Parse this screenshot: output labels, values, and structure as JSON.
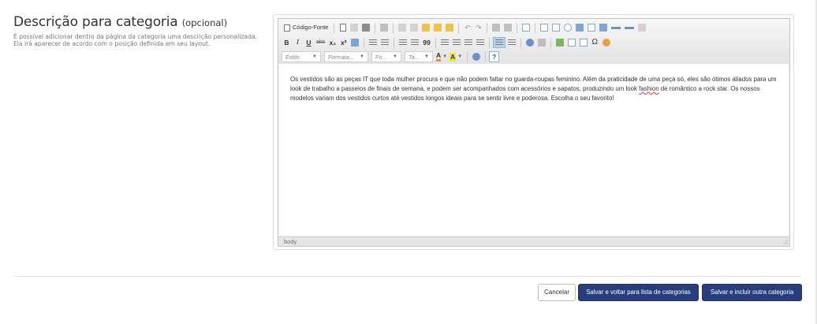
{
  "section": {
    "title": "Descrição para categoria",
    "optional_label": "(opcional)",
    "help_line1": "É possível adicionar dentro da página da categoria uma descrição personalizada.",
    "help_line2": "Ela irá aparecer de acordo com o posição definida em seu layout."
  },
  "editor": {
    "toolbar": {
      "source_label": "Código-Fonte",
      "bold_label": "B",
      "italic_label": "I",
      "underline_label": "U",
      "strike_label": "abc",
      "subscript_label": "x₂",
      "superscript_label": "x²",
      "blockquote_label": "99",
      "omega_label": "Ω",
      "style_combo": "Estilo",
      "format_combo": "Formata...",
      "font_combo": "Fo...",
      "size_combo": "Ta...",
      "text_color_label": "A",
      "bg_color_label": "A",
      "help_label": "?"
    },
    "content_before": "Os vestidos são as peças IT que toda mulher procura e que não podem faltar no guarda-roupas feminino. Além da praticidade de uma peça só, eles são ótimos aliados para um look de trabalho a passeios de finais de semana, e podem ser acompanhados com acessórios e sapatos, produzindo um look ",
    "content_misspelled": "fashion",
    "content_after": " de romântico a rock star. Os nossos modelos variam dos vestidos curtos até vestidos longos ideais para se sentir livre e poderosa. Escolha o seu favorito!",
    "status_path": "body"
  },
  "actions": {
    "cancel_label": "Cancelar",
    "save_back_label": "Salvar e voltar para lista de categorias",
    "save_new_label": "Salvar e incluir outra categoria"
  },
  "colors": {
    "primary_button": "#263e7e",
    "text_color_bar": "#e8931e",
    "bg_color_fill": "#f4e23a"
  }
}
